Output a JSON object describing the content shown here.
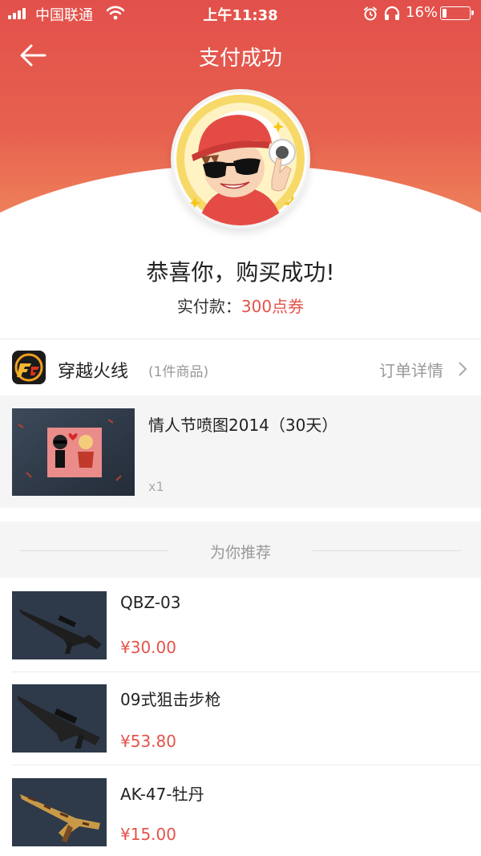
{
  "status_bar": {
    "carrier": "中国联通",
    "time": "上午11:38",
    "battery": "16%",
    "battery_level": 0.16,
    "icons": [
      "signal-icon",
      "wifi-icon",
      "alarm-icon",
      "headphone-icon",
      "battery-icon"
    ]
  },
  "header": {
    "title": "支付成功",
    "back_icon": "back-arrow-icon"
  },
  "result": {
    "message": "恭喜你，购买成功!",
    "paid_label": "实付款：",
    "paid_amount": "300点券"
  },
  "order": {
    "store_name": "穿越火线",
    "item_count": "(1件商品)",
    "detail_link": "订单详情",
    "product": {
      "name": "情人节喷图2014（30天）",
      "qty": "x1"
    }
  },
  "recommend": {
    "title": "为你推荐",
    "items": [
      {
        "name": "QBZ-03",
        "price": "¥30.00"
      },
      {
        "name": "09式狙击步枪",
        "price": "¥53.80"
      },
      {
        "name": "AK-47-牡丹",
        "price": "¥15.00"
      }
    ]
  },
  "colors": {
    "header": "#e2504b",
    "accent": "#e5534b"
  }
}
